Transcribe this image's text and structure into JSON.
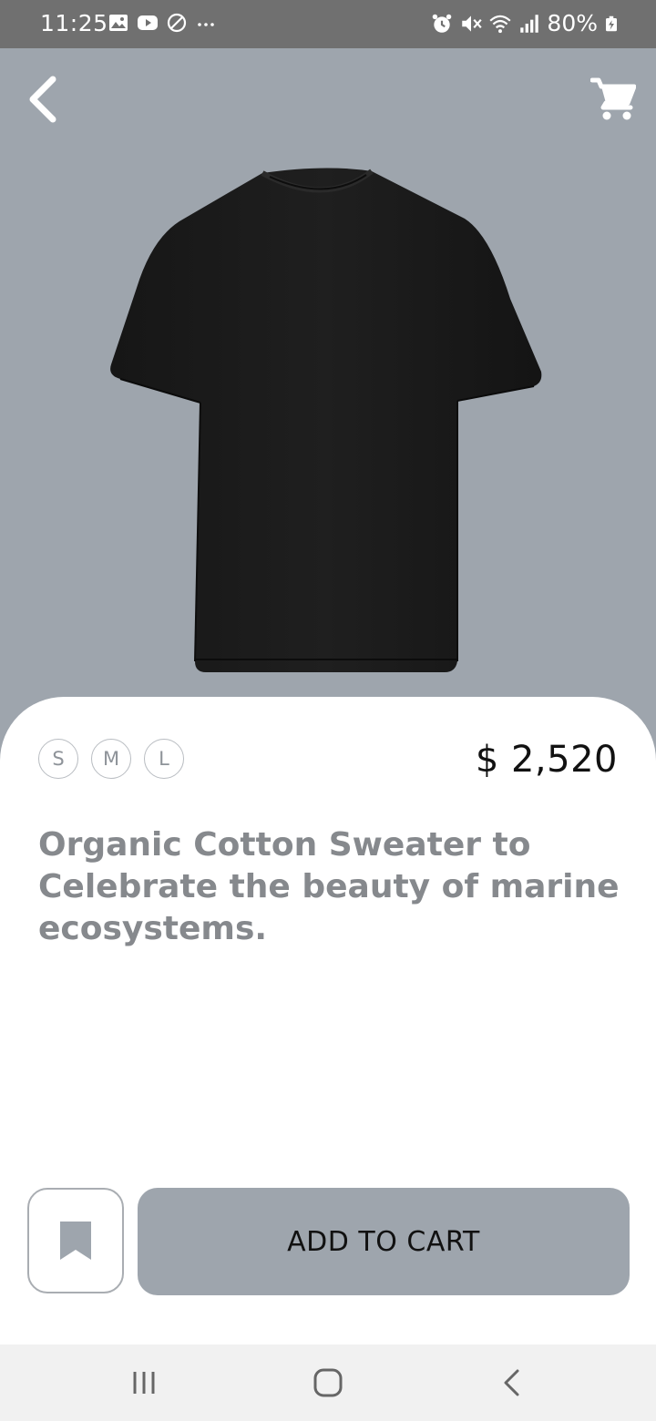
{
  "status_bar": {
    "time": "11:25",
    "battery": "80%",
    "left_icons": [
      "gallery-icon",
      "youtube-icon",
      "do-not-disturb-icon",
      "more-dots-icon"
    ],
    "right_icons": [
      "alarm-icon",
      "mute-icon",
      "wifi-icon",
      "signal-icon",
      "battery-charging-icon"
    ]
  },
  "header": {
    "back_icon": "chevron-left-icon",
    "cart_icon": "shopping-cart-icon"
  },
  "product": {
    "image": "black-t-shirt",
    "sizes": [
      "S",
      "M",
      "L"
    ],
    "price": "$ 2,520",
    "description": "Organic Cotton Sweater to Celebrate the beauty of marine ecosystems."
  },
  "actions": {
    "bookmark_icon": "bookmark-icon",
    "add_to_cart_label": "ADD TO CART"
  },
  "nav_bar": {
    "icons": [
      "recents-icon",
      "home-icon",
      "back-icon"
    ]
  },
  "colors": {
    "hero_background": "#9ea5ad",
    "button_background": "#9ea5ad",
    "description_text": "#86898d",
    "status_bar": "#707070",
    "nav_bar": "#f1f1f1"
  }
}
